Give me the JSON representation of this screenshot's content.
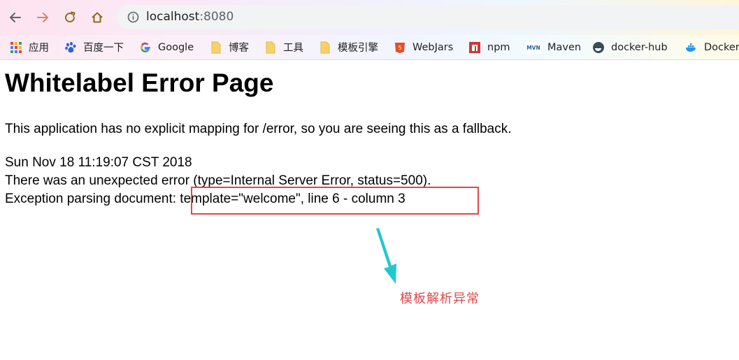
{
  "browser": {
    "url_host": "localhost",
    "url_port": ":8080"
  },
  "bookmarks": [
    {
      "label": "应用",
      "icon": "apps-grid-icon"
    },
    {
      "label": "百度一下",
      "icon": "baidu-paw-icon"
    },
    {
      "label": "Google",
      "icon": "google-g-icon"
    },
    {
      "label": "博客",
      "icon": "folder-icon"
    },
    {
      "label": "工具",
      "icon": "folder-icon"
    },
    {
      "label": "模板引擎",
      "icon": "folder-icon"
    },
    {
      "label": "WebJars",
      "icon": "webjars-icon"
    },
    {
      "label": "npm",
      "icon": "npm-icon"
    },
    {
      "label": "Maven",
      "icon": "maven-icon"
    },
    {
      "label": "docker-hub",
      "icon": "docker-hub-icon"
    },
    {
      "label": "Docker",
      "icon": "docker-whale-icon"
    }
  ],
  "page": {
    "title": "Whitelabel Error Page",
    "description": "This application has no explicit mapping for /error, so you are seeing this as a fallback.",
    "timestamp": "Sun Nov 18 11:19:07 CST 2018",
    "error_line": "There was an unexpected error (type=Internal Server Error, status=500).",
    "exception_line": "Exception parsing document: template=\"welcome\", line 6 - column 3"
  },
  "annotation": {
    "text": "模板解析异常",
    "color": "#e0474a",
    "arrow_color": "#22c8cf"
  }
}
